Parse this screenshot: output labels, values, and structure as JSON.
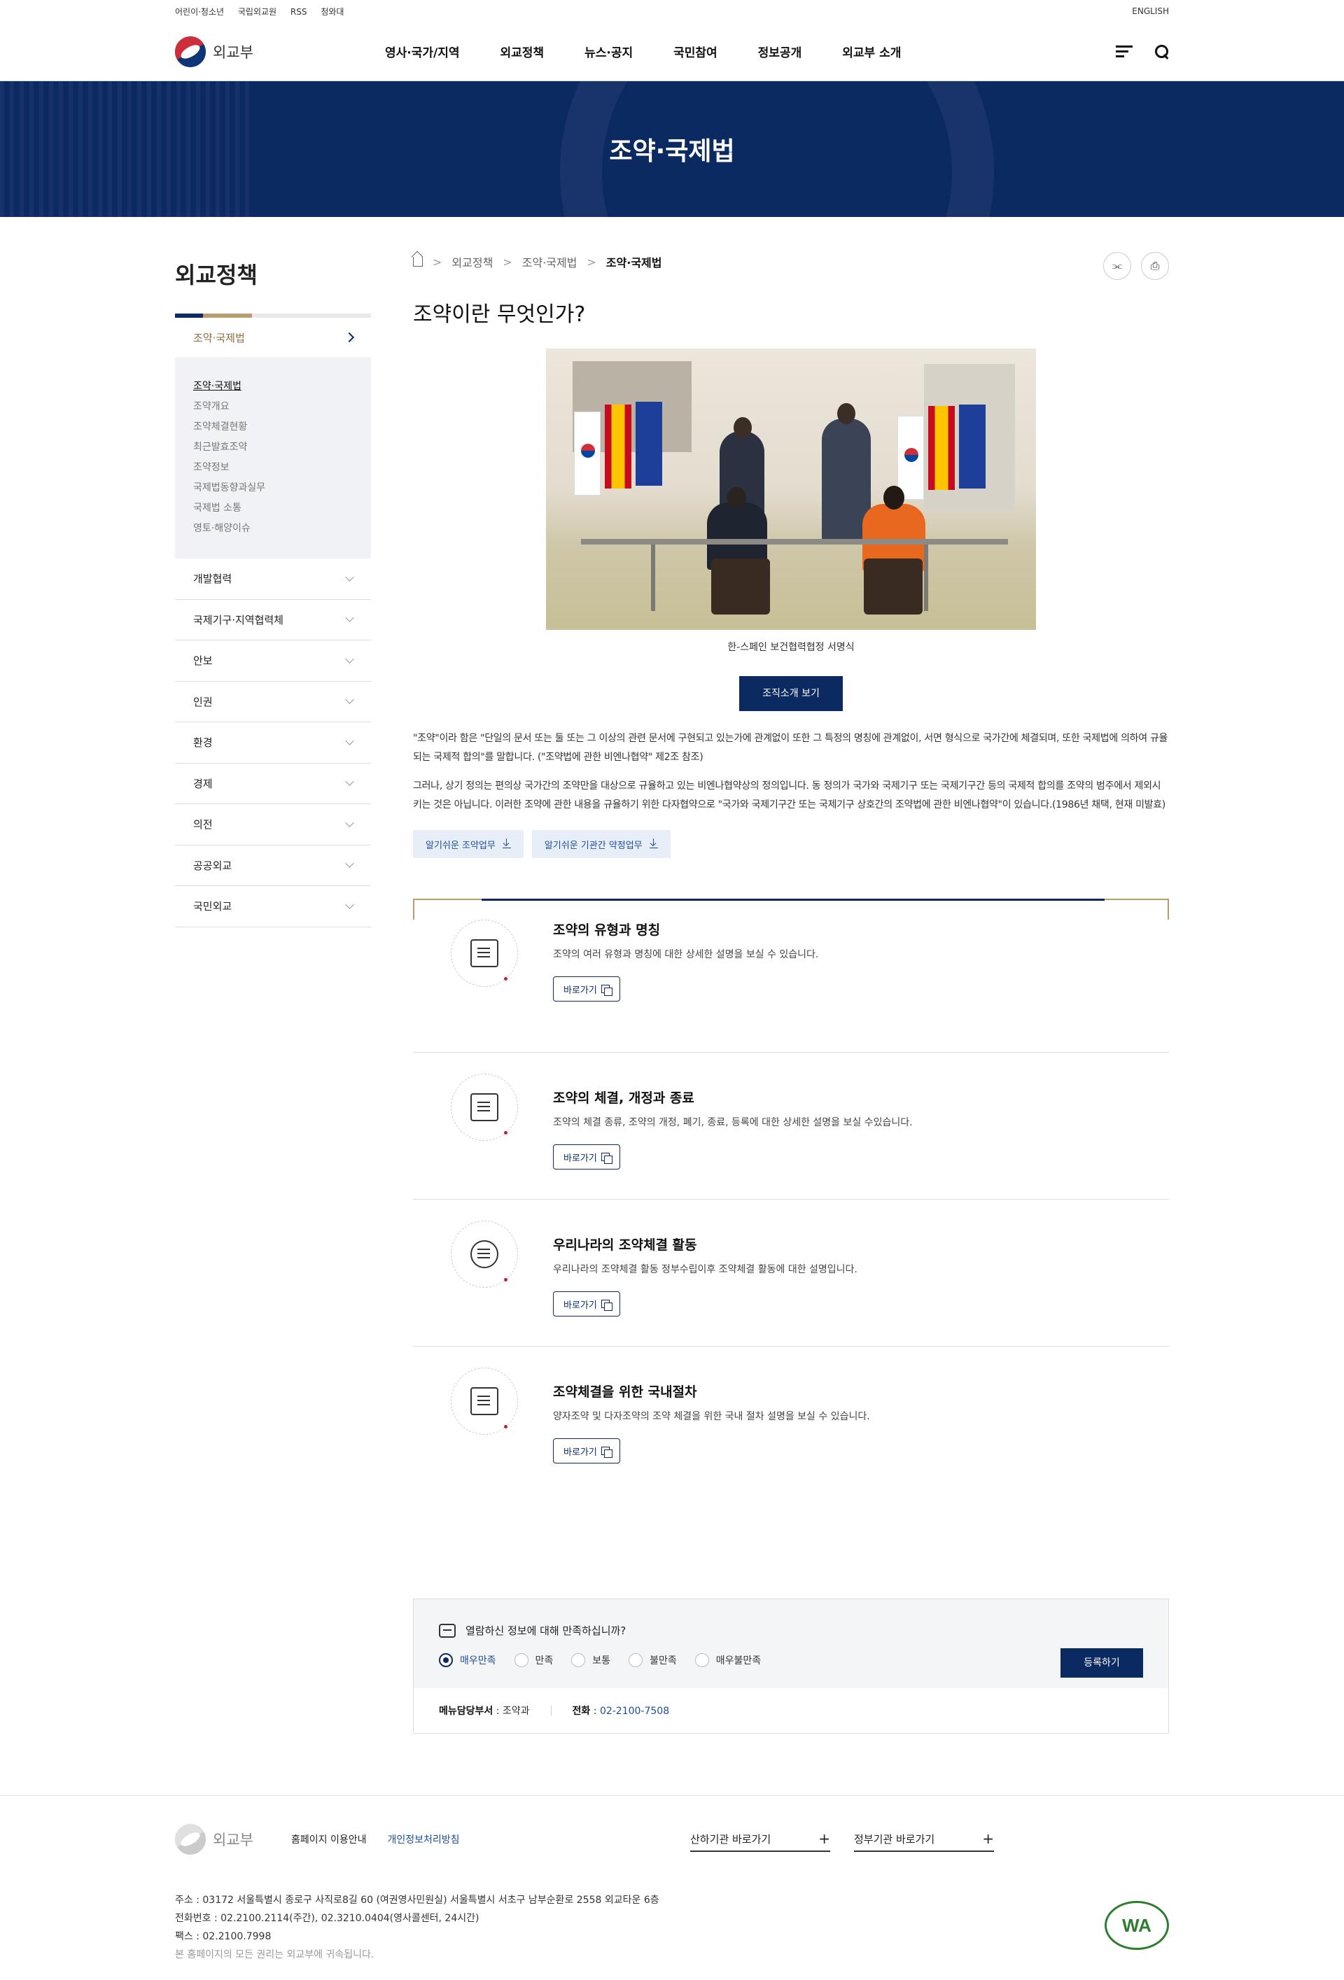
{
  "util": {
    "links": [
      "어린이·청소년",
      "국립외교원",
      "RSS",
      "청와대"
    ],
    "english": "ENGLISH"
  },
  "header": {
    "logo_text": "외교부",
    "nav": [
      "영사·국가/지역",
      "외교정책",
      "뉴스·공지",
      "국민참여",
      "정보공개",
      "외교부 소개"
    ]
  },
  "banner": {
    "title": "조약·국제법"
  },
  "sidebar": {
    "title": "외교정책",
    "active": "조약·국제법",
    "sub_items": [
      "조약·국제법",
      "조약개요",
      "조약체결현황",
      "최근발효조약",
      "조약정보",
      "국제법동향과실무",
      "국제법 소통",
      "영토·해양이슈"
    ],
    "items": [
      "개발협력",
      "국제기구·지역협력체",
      "안보",
      "인권",
      "환경",
      "경제",
      "의전",
      "공공외교",
      "국민외교"
    ]
  },
  "breadcrumb": [
    "외교정책",
    "조약·국제법",
    "조약·국제법"
  ],
  "main": {
    "title": "조약이란 무엇인가?",
    "caption": "한-스페인 보건협력협정 서명식",
    "org_button": "조직소개 보기",
    "para1": "\"조약\"이라 함은 \"단일의 문서 또는 둘 또는 그 이상의 관련 문서에 구현되고 있는가에 관계없이 또한 그 특정의 명칭에 관계없이, 서면 형식으로 국가간에 체결되며, 또한 국제법에 의하여 규율되는 국제적 합의\"를 말합니다. (\"조약법에 관한 비엔나협약\" 제2조 참조)",
    "para2": "그러나, 상기 정의는 편의상 국가간의 조약만을 대상으로 규율하고 있는 비엔나협약상의 정의입니다. 동 정의가 국가와 국제기구 또는 국제기구간 등의 국제적 합의를 조약의 범주에서 제외시키는 것은 아닙니다. 이러한 조약에 관한 내용을 규율하기 위한 다자협약으로 \"국가와 국제기구간 또는 국제기구 상호간의 조약법에 관한 비엔나협약\"이 있습니다.(1986년 채택, 현재 미발효)",
    "downloads": [
      "알기쉬운 조약업무",
      "알기쉬운 기관간 약정업무"
    ]
  },
  "cards": [
    {
      "title": "조약의 유형과 명칭",
      "desc": "조약의 여러 유형과 명칭에 대한 상세한 설명을 보실 수 있습니다.",
      "button": "바로가기",
      "icon": "book-icon"
    },
    {
      "title": "조약의 체결, 개정과 종료",
      "desc": "조약의 체결 종류, 조약의 개정, 폐기, 종료, 등록에 대한 상세한 설명을 보실 수있습니다.",
      "button": "바로가기",
      "icon": "document-bookmark-icon"
    },
    {
      "title": "우리나라의 조약체결 활동",
      "desc": "우리나라의 조약체결 활동 정부수립이후 조약체결 활동에 대한 설명입니다.",
      "button": "바로가기",
      "icon": "people-icon"
    },
    {
      "title": "조약체결을 위한 국내절차",
      "desc": "양자조약 및 다자조약의 조약 체결을 위한 국내 절차 설명을 보실 수 있습니다.",
      "button": "바로가기",
      "icon": "procedure-icon"
    }
  ],
  "survey": {
    "question": "열람하신 정보에 대해 만족하십니까?",
    "options": [
      "매우만족",
      "만족",
      "보통",
      "불만족",
      "매우불만족"
    ],
    "selected": "매우만족",
    "submit": "등록하기",
    "dept_label": "메뉴담당부서",
    "dept": "조약과",
    "tel_label": "전화",
    "tel": "02-2100-7508"
  },
  "footer": {
    "logo_text": "외교부",
    "links": [
      "홈페이지 이용안내",
      "개인정보처리방침"
    ],
    "select1": "산하기관 바로가기",
    "select2": "정부기관 바로가기",
    "address": "주소 : 03172 서울특별시 종로구 사직로8길 60 (여권영사민원실) 서울특별시 서초구 남부순환로 2558 외교타운 6층",
    "phone": "전화번호 : 02.2100.2114(주간), 02.3210.0404(영사콜센터, 24시간)",
    "fax": "팩스 : 02.2100.7998",
    "copyright": "본 홈페이지의 모든 권리는 외교부에 귀속됩니다.",
    "badge": "WA"
  }
}
